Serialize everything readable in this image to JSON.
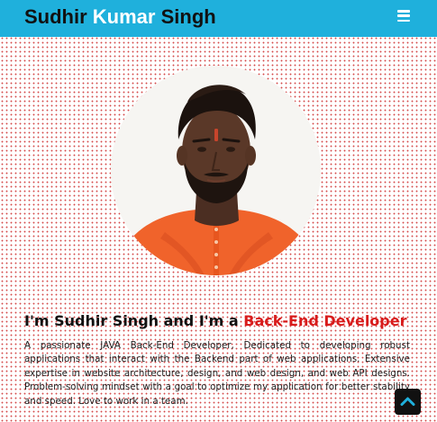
{
  "header": {
    "brand_first": "Sudhir",
    "brand_middle": "Kumar",
    "brand_last": "Singh",
    "menu_icon": "hamburger-menu-icon",
    "background_color": "#1fb0dc",
    "accent_color": "#ffffff"
  },
  "hero": {
    "headline_prefix": "I'm Sudhir Singh and I'm a",
    "headline_role": "Back-End Developer",
    "role_color": "#d81b1b",
    "bio": "A passionate JAVA Back-End Developer, Dedicated to developing robust applications that interact with the Backend part of web applications. Extensive expertise in website architecture, design, and web design, and web API designs. Problem-solving mindset with a goal to optimize my application for better stability and speed. Love to work in a team."
  },
  "scroll_top": {
    "icon": "chevron-up-icon"
  }
}
